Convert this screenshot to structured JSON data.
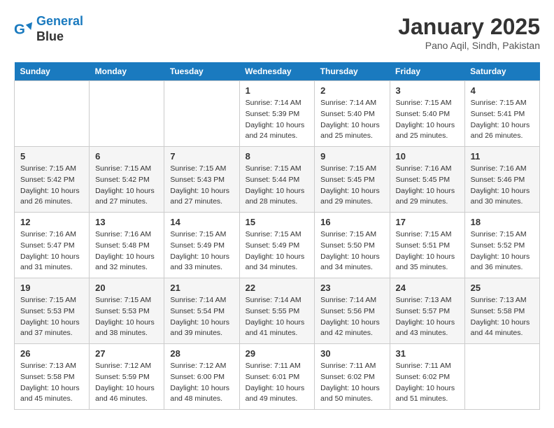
{
  "header": {
    "logo_line1": "General",
    "logo_line2": "Blue",
    "title": "January 2025",
    "subtitle": "Pano Aqil, Sindh, Pakistan"
  },
  "days_of_week": [
    "Sunday",
    "Monday",
    "Tuesday",
    "Wednesday",
    "Thursday",
    "Friday",
    "Saturday"
  ],
  "weeks": [
    [
      {
        "day": "",
        "sunrise": "",
        "sunset": "",
        "daylight": ""
      },
      {
        "day": "",
        "sunrise": "",
        "sunset": "",
        "daylight": ""
      },
      {
        "day": "",
        "sunrise": "",
        "sunset": "",
        "daylight": ""
      },
      {
        "day": "1",
        "sunrise": "Sunrise: 7:14 AM",
        "sunset": "Sunset: 5:39 PM",
        "daylight": "Daylight: 10 hours and 24 minutes."
      },
      {
        "day": "2",
        "sunrise": "Sunrise: 7:14 AM",
        "sunset": "Sunset: 5:40 PM",
        "daylight": "Daylight: 10 hours and 25 minutes."
      },
      {
        "day": "3",
        "sunrise": "Sunrise: 7:15 AM",
        "sunset": "Sunset: 5:40 PM",
        "daylight": "Daylight: 10 hours and 25 minutes."
      },
      {
        "day": "4",
        "sunrise": "Sunrise: 7:15 AM",
        "sunset": "Sunset: 5:41 PM",
        "daylight": "Daylight: 10 hours and 26 minutes."
      }
    ],
    [
      {
        "day": "5",
        "sunrise": "Sunrise: 7:15 AM",
        "sunset": "Sunset: 5:42 PM",
        "daylight": "Daylight: 10 hours and 26 minutes."
      },
      {
        "day": "6",
        "sunrise": "Sunrise: 7:15 AM",
        "sunset": "Sunset: 5:42 PM",
        "daylight": "Daylight: 10 hours and 27 minutes."
      },
      {
        "day": "7",
        "sunrise": "Sunrise: 7:15 AM",
        "sunset": "Sunset: 5:43 PM",
        "daylight": "Daylight: 10 hours and 27 minutes."
      },
      {
        "day": "8",
        "sunrise": "Sunrise: 7:15 AM",
        "sunset": "Sunset: 5:44 PM",
        "daylight": "Daylight: 10 hours and 28 minutes."
      },
      {
        "day": "9",
        "sunrise": "Sunrise: 7:15 AM",
        "sunset": "Sunset: 5:45 PM",
        "daylight": "Daylight: 10 hours and 29 minutes."
      },
      {
        "day": "10",
        "sunrise": "Sunrise: 7:16 AM",
        "sunset": "Sunset: 5:45 PM",
        "daylight": "Daylight: 10 hours and 29 minutes."
      },
      {
        "day": "11",
        "sunrise": "Sunrise: 7:16 AM",
        "sunset": "Sunset: 5:46 PM",
        "daylight": "Daylight: 10 hours and 30 minutes."
      }
    ],
    [
      {
        "day": "12",
        "sunrise": "Sunrise: 7:16 AM",
        "sunset": "Sunset: 5:47 PM",
        "daylight": "Daylight: 10 hours and 31 minutes."
      },
      {
        "day": "13",
        "sunrise": "Sunrise: 7:16 AM",
        "sunset": "Sunset: 5:48 PM",
        "daylight": "Daylight: 10 hours and 32 minutes."
      },
      {
        "day": "14",
        "sunrise": "Sunrise: 7:15 AM",
        "sunset": "Sunset: 5:49 PM",
        "daylight": "Daylight: 10 hours and 33 minutes."
      },
      {
        "day": "15",
        "sunrise": "Sunrise: 7:15 AM",
        "sunset": "Sunset: 5:49 PM",
        "daylight": "Daylight: 10 hours and 34 minutes."
      },
      {
        "day": "16",
        "sunrise": "Sunrise: 7:15 AM",
        "sunset": "Sunset: 5:50 PM",
        "daylight": "Daylight: 10 hours and 34 minutes."
      },
      {
        "day": "17",
        "sunrise": "Sunrise: 7:15 AM",
        "sunset": "Sunset: 5:51 PM",
        "daylight": "Daylight: 10 hours and 35 minutes."
      },
      {
        "day": "18",
        "sunrise": "Sunrise: 7:15 AM",
        "sunset": "Sunset: 5:52 PM",
        "daylight": "Daylight: 10 hours and 36 minutes."
      }
    ],
    [
      {
        "day": "19",
        "sunrise": "Sunrise: 7:15 AM",
        "sunset": "Sunset: 5:53 PM",
        "daylight": "Daylight: 10 hours and 37 minutes."
      },
      {
        "day": "20",
        "sunrise": "Sunrise: 7:15 AM",
        "sunset": "Sunset: 5:53 PM",
        "daylight": "Daylight: 10 hours and 38 minutes."
      },
      {
        "day": "21",
        "sunrise": "Sunrise: 7:14 AM",
        "sunset": "Sunset: 5:54 PM",
        "daylight": "Daylight: 10 hours and 39 minutes."
      },
      {
        "day": "22",
        "sunrise": "Sunrise: 7:14 AM",
        "sunset": "Sunset: 5:55 PM",
        "daylight": "Daylight: 10 hours and 41 minutes."
      },
      {
        "day": "23",
        "sunrise": "Sunrise: 7:14 AM",
        "sunset": "Sunset: 5:56 PM",
        "daylight": "Daylight: 10 hours and 42 minutes."
      },
      {
        "day": "24",
        "sunrise": "Sunrise: 7:13 AM",
        "sunset": "Sunset: 5:57 PM",
        "daylight": "Daylight: 10 hours and 43 minutes."
      },
      {
        "day": "25",
        "sunrise": "Sunrise: 7:13 AM",
        "sunset": "Sunset: 5:58 PM",
        "daylight": "Daylight: 10 hours and 44 minutes."
      }
    ],
    [
      {
        "day": "26",
        "sunrise": "Sunrise: 7:13 AM",
        "sunset": "Sunset: 5:58 PM",
        "daylight": "Daylight: 10 hours and 45 minutes."
      },
      {
        "day": "27",
        "sunrise": "Sunrise: 7:12 AM",
        "sunset": "Sunset: 5:59 PM",
        "daylight": "Daylight: 10 hours and 46 minutes."
      },
      {
        "day": "28",
        "sunrise": "Sunrise: 7:12 AM",
        "sunset": "Sunset: 6:00 PM",
        "daylight": "Daylight: 10 hours and 48 minutes."
      },
      {
        "day": "29",
        "sunrise": "Sunrise: 7:11 AM",
        "sunset": "Sunset: 6:01 PM",
        "daylight": "Daylight: 10 hours and 49 minutes."
      },
      {
        "day": "30",
        "sunrise": "Sunrise: 7:11 AM",
        "sunset": "Sunset: 6:02 PM",
        "daylight": "Daylight: 10 hours and 50 minutes."
      },
      {
        "day": "31",
        "sunrise": "Sunrise: 7:11 AM",
        "sunset": "Sunset: 6:02 PM",
        "daylight": "Daylight: 10 hours and 51 minutes."
      },
      {
        "day": "",
        "sunrise": "",
        "sunset": "",
        "daylight": ""
      }
    ]
  ]
}
